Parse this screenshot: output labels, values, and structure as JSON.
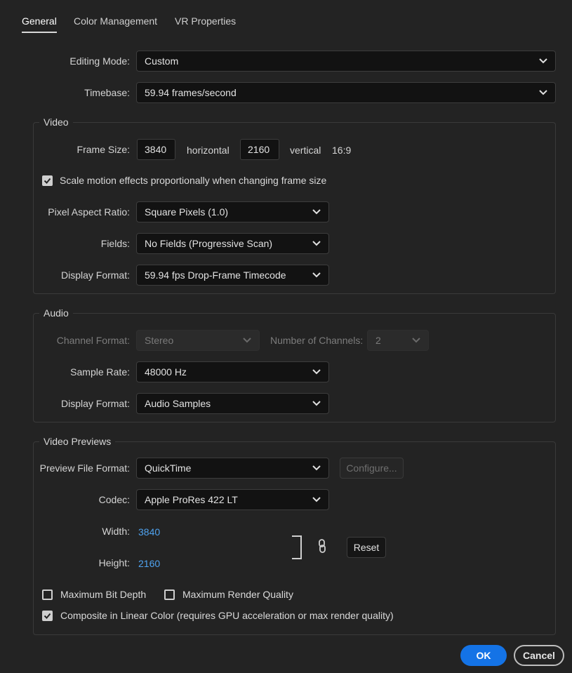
{
  "tabs": [
    {
      "label": "General",
      "active": true
    },
    {
      "label": "Color Management",
      "active": false
    },
    {
      "label": "VR Properties",
      "active": false
    }
  ],
  "general": {
    "editing_mode": {
      "label": "Editing Mode:",
      "value": "Custom"
    },
    "timebase": {
      "label": "Timebase:",
      "value": "59.94  frames/second"
    }
  },
  "video": {
    "title": "Video",
    "frame_size_label": "Frame Size:",
    "width": "3840",
    "horizontal_label": "horizontal",
    "height": "2160",
    "vertical_label": "vertical",
    "aspect": "16:9",
    "scale_motion": {
      "label": "Scale motion effects proportionally when changing frame size",
      "checked": true
    },
    "pixel_aspect": {
      "label": "Pixel Aspect Ratio:",
      "value": "Square Pixels (1.0)"
    },
    "fields": {
      "label": "Fields:",
      "value": "No Fields (Progressive Scan)"
    },
    "display_format": {
      "label": "Display Format:",
      "value": "59.94 fps Drop-Frame Timecode"
    }
  },
  "audio": {
    "title": "Audio",
    "channel_format": {
      "label": "Channel Format:",
      "value": "Stereo",
      "disabled": true
    },
    "num_channels": {
      "label": "Number of Channels:",
      "value": "2",
      "disabled": true
    },
    "sample_rate": {
      "label": "Sample Rate:",
      "value": "48000 Hz"
    },
    "display_format": {
      "label": "Display Format:",
      "value": "Audio Samples"
    }
  },
  "previews": {
    "title": "Video Previews",
    "file_format": {
      "label": "Preview File Format:",
      "value": "QuickTime"
    },
    "configure_label": "Configure...",
    "codec": {
      "label": "Codec:",
      "value": "Apple ProRes 422 LT"
    },
    "width": {
      "label": "Width:",
      "value": "3840"
    },
    "height": {
      "label": "Height:",
      "value": "2160"
    },
    "reset_label": "Reset",
    "max_bit_depth": {
      "label": "Maximum Bit Depth",
      "checked": false
    },
    "max_render_quality": {
      "label": "Maximum Render Quality",
      "checked": false
    },
    "linear_color": {
      "label": "Composite in Linear Color (requires GPU acceleration or max render quality)",
      "checked": true
    }
  },
  "footer": {
    "ok_label": "OK",
    "cancel_label": "Cancel"
  },
  "colors": {
    "accent": "#1473e6",
    "link_value": "#4fa3f0",
    "background": "#232323"
  }
}
